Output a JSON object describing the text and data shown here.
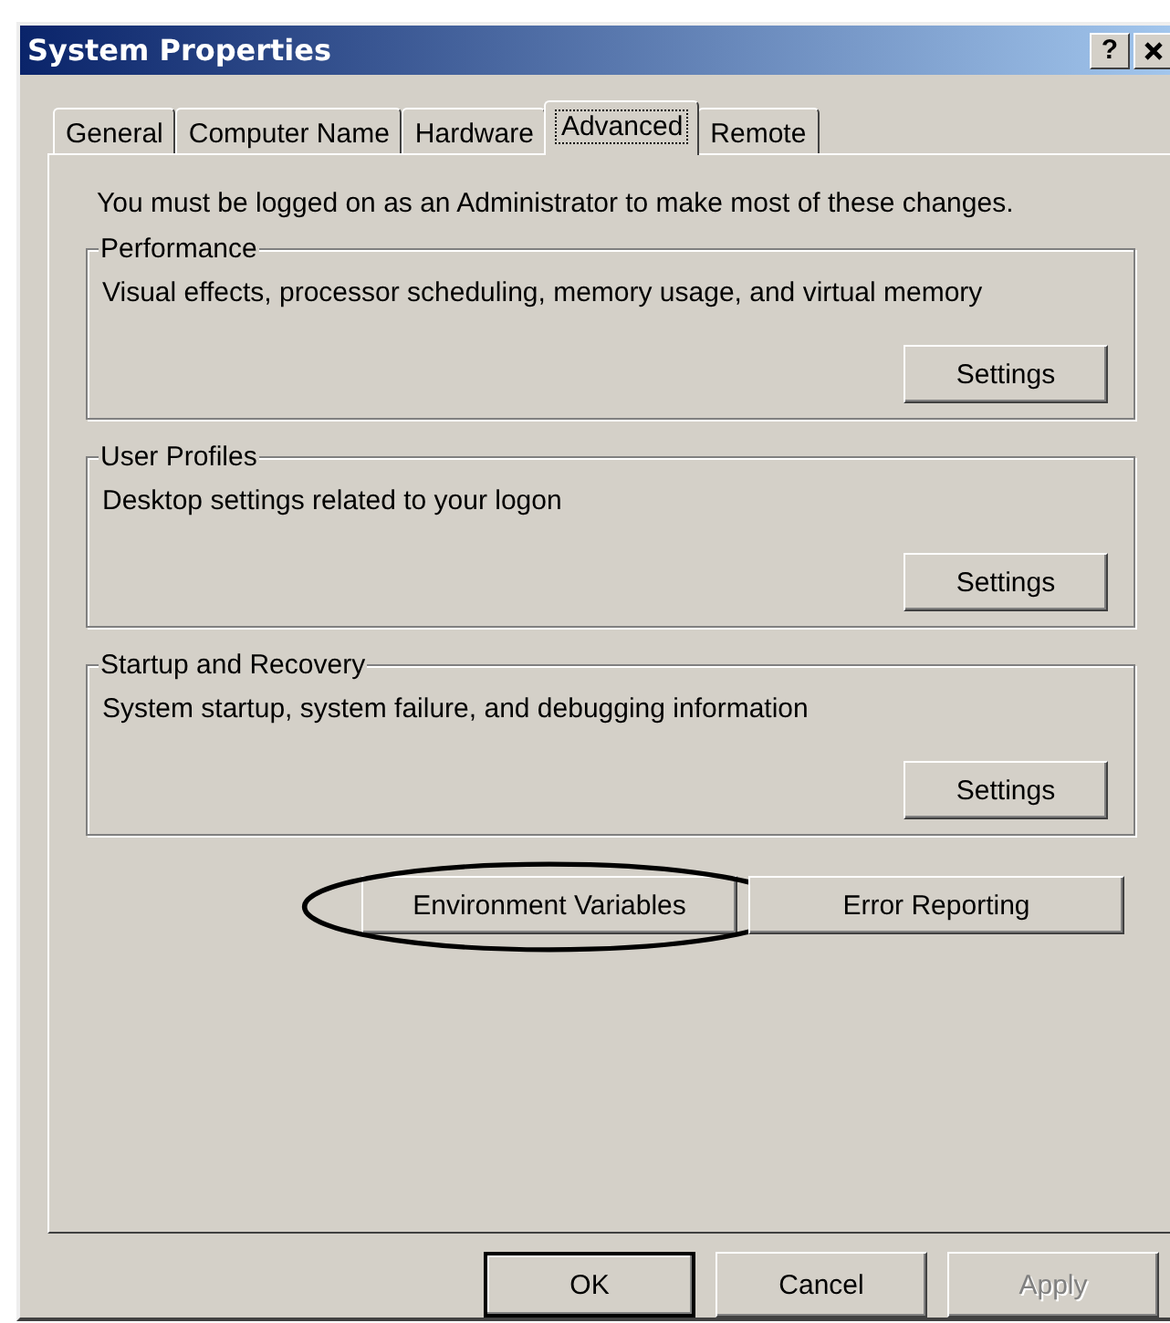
{
  "window": {
    "title": "System Properties",
    "help": "?"
  },
  "tabs": [
    {
      "label": "General",
      "selected": false
    },
    {
      "label": "Computer Name",
      "selected": false
    },
    {
      "label": "Hardware",
      "selected": false
    },
    {
      "label": "Advanced",
      "selected": true
    },
    {
      "label": "Remote",
      "selected": false
    }
  ],
  "notice": "You must be logged on as an Administrator to make most of these changes.",
  "groups": [
    {
      "title": "Performance",
      "description": "Visual effects, processor scheduling, memory usage, and virtual memory",
      "button": "Settings"
    },
    {
      "title": "User Profiles",
      "description": "Desktop settings related to your logon",
      "button": "Settings"
    },
    {
      "title": "Startup and Recovery",
      "description": "System startup, system failure, and debugging information",
      "button": "Settings"
    }
  ],
  "extra_buttons": [
    {
      "label": "Environment Variables",
      "circled": true
    },
    {
      "label": "Error Reporting",
      "circled": false
    }
  ],
  "dialog_buttons": [
    {
      "label": "OK",
      "default": true,
      "disabled": false
    },
    {
      "label": "Cancel",
      "default": false,
      "disabled": false
    },
    {
      "label": "Apply",
      "default": false,
      "disabled": true
    }
  ]
}
